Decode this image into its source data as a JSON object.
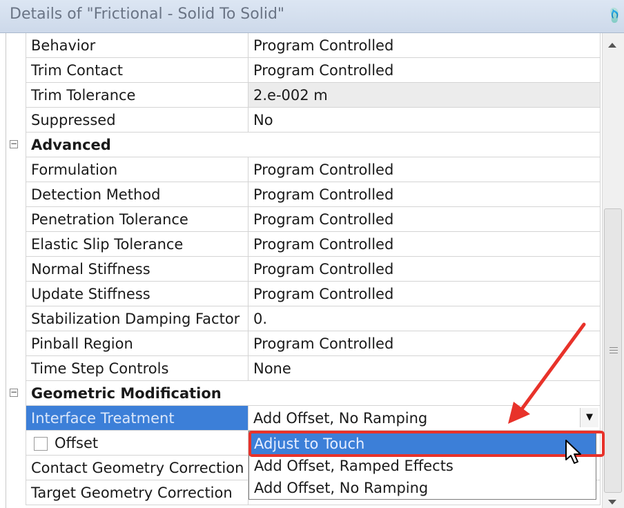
{
  "panel": {
    "title": "Details of \"Frictional - Solid To Solid\"",
    "pin_icon": "pin-icon"
  },
  "rows": {
    "behavior": {
      "name": "Behavior",
      "value": "Program Controlled"
    },
    "trim_contact": {
      "name": "Trim Contact",
      "value": "Program Controlled"
    },
    "trim_tol": {
      "name": "Trim Tolerance",
      "value": "2.e-002 m"
    },
    "suppressed": {
      "name": "Suppressed",
      "value": "No"
    },
    "advanced": {
      "name": "Advanced",
      "expander": "−"
    },
    "formulation": {
      "name": "Formulation",
      "value": "Program Controlled"
    },
    "detection": {
      "name": "Detection Method",
      "value": "Program Controlled"
    },
    "penetration": {
      "name": "Penetration Tolerance",
      "value": "Program Controlled"
    },
    "elastic_slip": {
      "name": "Elastic Slip Tolerance",
      "value": "Program Controlled"
    },
    "normal_stiff": {
      "name": "Normal Stiffness",
      "value": "Program Controlled"
    },
    "update_stiff": {
      "name": "Update Stiffness",
      "value": "Program Controlled"
    },
    "stab_damp": {
      "name": "Stabilization Damping Factor",
      "value": "0."
    },
    "pinball": {
      "name": "Pinball Region",
      "value": "Program Controlled"
    },
    "time_step": {
      "name": "Time Step Controls",
      "value": "None"
    },
    "geo_mod": {
      "name": "Geometric Modification",
      "expander": "−"
    },
    "interface": {
      "name": "Interface Treatment",
      "value": "Add Offset, No Ramping",
      "dropdown_icon": "▼"
    },
    "offset": {
      "name": "Offset"
    },
    "contact_geo": {
      "name": "Contact Geometry Correction"
    },
    "target_geo": {
      "name": "Target Geometry Correction"
    }
  },
  "dropdown": {
    "options": [
      "Adjust to Touch",
      "Add Offset, Ramped Effects",
      "Add Offset, No Ramping"
    ],
    "highlighted": "Adjust to Touch"
  },
  "colors": {
    "selection": "#3c7fd8",
    "annotation": "#e8322a"
  },
  "scrollbar": {
    "position_fraction": 0.68
  }
}
